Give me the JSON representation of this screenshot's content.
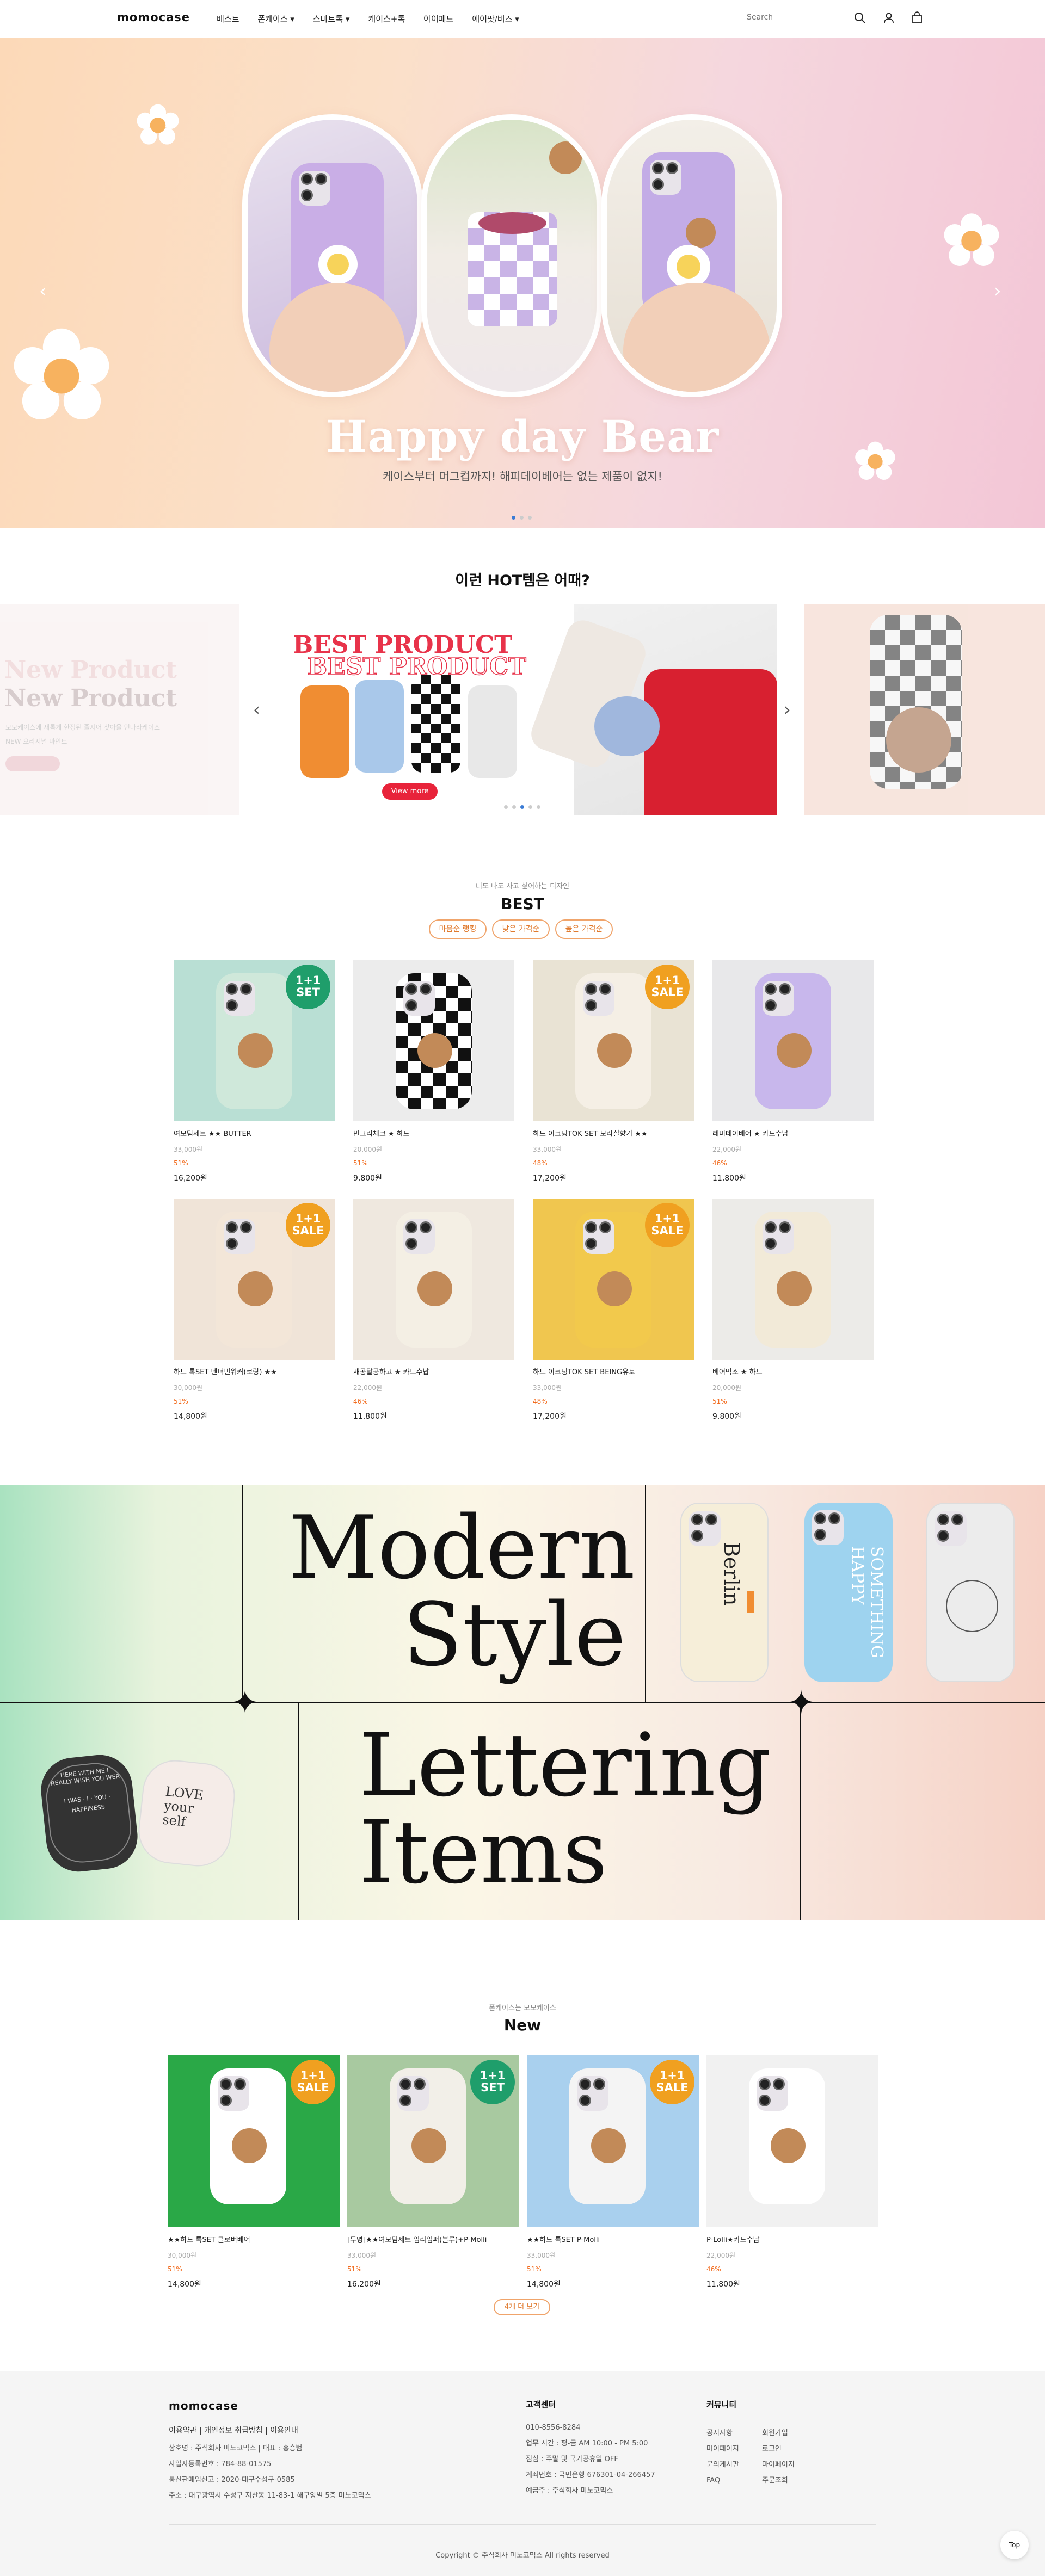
{
  "header": {
    "logo": "momocase",
    "nav": [
      "베스트",
      "폰케이스 ▾",
      "스마트톡 ▾",
      "케이스+톡",
      "아이패드",
      "에어팟/버즈 ▾"
    ],
    "search_placeholder": "Search"
  },
  "hero": {
    "title": "Happy day Bear",
    "subtitle": "케이스부터 머그컵까지! 해피데이베어는 없는 제품이 없지!"
  },
  "hot": {
    "title": "이런 HOT템은 어때?",
    "left_banner_title": "New Product",
    "left_banner_text": "모모케이스에 새롭게 한정된 줄지어 찾아올 인나라케이스",
    "left_banner_text2": "NEW 오리지널 마인트",
    "center_title": "BEST PRODUCT",
    "center_button": "View more"
  },
  "best": {
    "kicker": "너도 나도 사고 싶어하는 디자인",
    "title": "BEST",
    "tabs": [
      "마음순 랭킹",
      "낮은 가격순",
      "높은 가격순"
    ],
    "products": [
      {
        "name": "여모팀세트 ★★ BUTTER",
        "orig": "33,000원",
        "disc": "51%",
        "price": "16,200원",
        "badge": "1+1 SET"
      },
      {
        "name": "빈그리체크 ★ 하드",
        "orig": "20,000원",
        "disc": "51%",
        "price": "9,800원",
        "badge": ""
      },
      {
        "name": "하드 이크팅TOK SET 보라칠향기 ★★",
        "orig": "33,000원",
        "disc": "48%",
        "price": "17,200원",
        "badge": "1+1 SALE"
      },
      {
        "name": "레미데이베어 ★ 카드수납",
        "orig": "22,000원",
        "disc": "46%",
        "price": "11,800원",
        "badge": ""
      },
      {
        "name": "하드 톡SET 덴더빈워커(코랑) ★★",
        "orig": "30,000원",
        "disc": "51%",
        "price": "14,800원",
        "badge": "1+1 SALE"
      },
      {
        "name": "새공달공하고 ★ 카드수납",
        "orig": "22,000원",
        "disc": "46%",
        "price": "11,800원",
        "badge": ""
      },
      {
        "name": "하드 이크팅TOK SET BEING유토",
        "orig": "33,000원",
        "disc": "48%",
        "price": "17,200원",
        "badge": "1+1 SALE"
      },
      {
        "name": "베어먹조 ★ 하드",
        "orig": "20,000원",
        "disc": "51%",
        "price": "9,800원",
        "badge": ""
      }
    ]
  },
  "banner": {
    "modern_line1": "Modern",
    "modern_line2": "Style",
    "lettering_line1": "Lettering",
    "lettering_line2": "Items",
    "case1_text": "Berlin",
    "case2_text": "SOMETHING HAPPY",
    "grip1_text": "HERE WITH ME I REALLY WISH YOU WER",
    "grip1_center": "I WAS · I · YOU · HAPPINESS",
    "grip2_text": "LOVE your self"
  },
  "new": {
    "kicker": "폰케이스는 모모케이스",
    "title": "New",
    "more_button": "4개 더 보기",
    "products": [
      {
        "name": "★★하드 톡SET 클로버베어",
        "orig": "30,000원",
        "disc": "51%",
        "price": "14,800원",
        "badge": "1+1 SALE"
      },
      {
        "name": "[투명]★★여모팀세트 업리업퍼(블루)+P-Molli",
        "orig": "33,000원",
        "disc": "51%",
        "price": "16,200원",
        "badge": "1+1 SET"
      },
      {
        "name": "★★하드 톡SET P-Molli",
        "orig": "33,000원",
        "disc": "51%",
        "price": "14,800원",
        "badge": "1+1 SALE"
      },
      {
        "name": "P-Lolli★카드수납",
        "orig": "22,000원",
        "disc": "46%",
        "price": "11,800원",
        "badge": ""
      }
    ]
  },
  "footer": {
    "logo": "momocase",
    "links": "이용약관  |  개인정보 취급방침  |  이용안내",
    "info": [
      "상호명 : 주식회사 미노코믹스  |  대표 : 홍승범",
      "사업자등록번호 : 784-88-01575",
      "통신판매업신고 : 2020-대구수성구-0585",
      "주소 : 대구광역시 수성구 지산동 11-83-1 해구양빌 5층 미노코믹스"
    ],
    "cs_title": "고객센터",
    "cs": [
      "010-8556-8284",
      "업무 시간 : 평-금 AM 10:00 - PM 5:00",
      "점심 : 주말 및 국가공휴일 OFF",
      "계좌번호 : 국민은행 676301-04-266457",
      "예금주 : 주식회사 미노코믹스"
    ],
    "community_title": "커뮤니티",
    "community_col1": [
      "공지사항",
      "마이페이지",
      "문의게시판",
      "FAQ"
    ],
    "community_col2": [
      "회원가입",
      "로그인",
      "마이페이지",
      "주문조회"
    ],
    "copyright": "Copyright © 주식회사 미노코믹스 All rights reserved",
    "top_button": "Top"
  },
  "colors": {
    "accent": "#f26b1d",
    "badge_green": "#1f9e6b",
    "badge_orange": "#f0a020",
    "dot_active": "#3a7bd5"
  }
}
